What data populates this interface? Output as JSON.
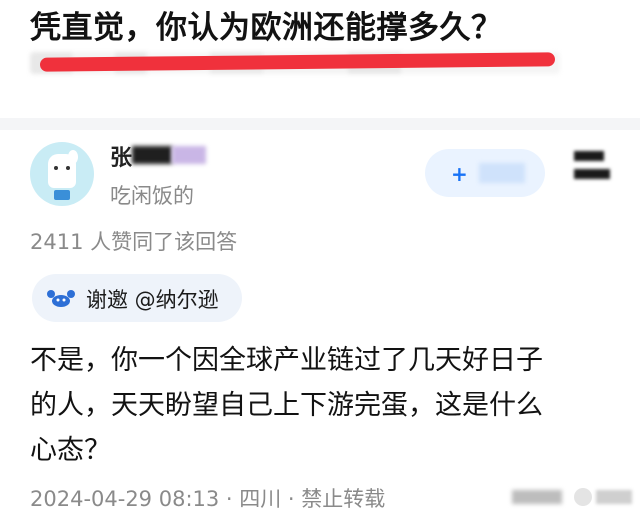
{
  "question": {
    "title": "凭直觉，你认为欧洲还能撑多久？"
  },
  "author": {
    "name_visible": "张",
    "bio": "吃闲饭的"
  },
  "follow_button": {
    "icon": "plus-icon"
  },
  "answer": {
    "upvote_text": "2411 人赞同了该回答",
    "invite_label": "谢邀 @纳尔逊",
    "body_lines": [
      "不是，你一个因全球产业链过了几天好日子",
      "的人，天天盼望自己上下游完蛋，这是什么",
      "心态？"
    ],
    "meta": "2024-04-29 08:13 · 四川 · 禁止转载"
  },
  "colors": {
    "accent_blue": "#1772f6",
    "highlight_red": "#f0313c",
    "muted_text": "#8a8a8a"
  }
}
